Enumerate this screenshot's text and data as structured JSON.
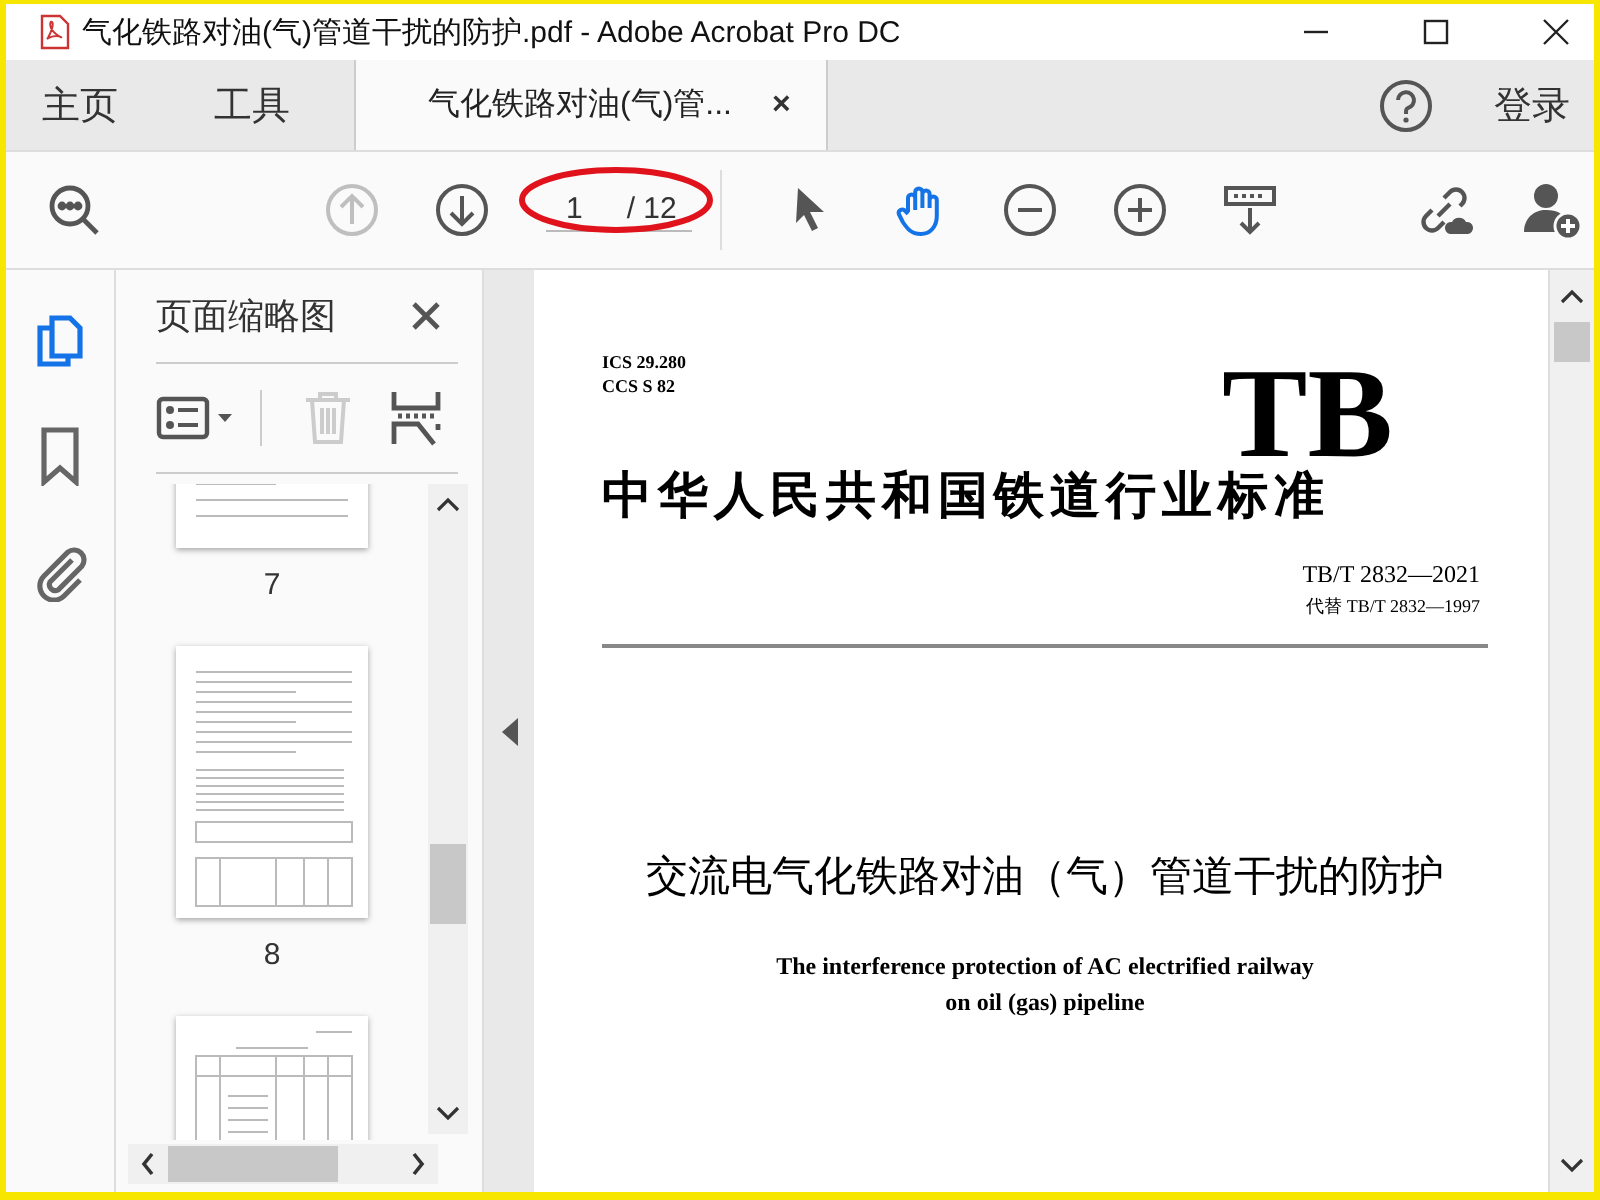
{
  "window": {
    "title": "气化铁路对油(气)管道干扰的防护.pdf - Adobe Acrobat Pro DC"
  },
  "nav_tabs": [
    {
      "label": "主页",
      "selected": false
    },
    {
      "label": "工具",
      "selected": false
    }
  ],
  "document_tab": {
    "label": "气化铁路对油(气)管...",
    "selected": true,
    "close": "×"
  },
  "account": {
    "label": "登录"
  },
  "nav_tools": [
    {
      "kind": "search",
      "disabled": false
    },
    {
      "kind": "page-up",
      "disabled": true
    },
    {
      "kind": "page-down",
      "disabled": false
    }
  ],
  "page_field": {
    "current": "1",
    "total": "/ 12"
  },
  "view_tools": [
    {
      "kind": "pointer",
      "selected": false
    },
    {
      "kind": "hand",
      "selected": true
    },
    {
      "kind": "zoom-out",
      "selected": false
    },
    {
      "kind": "zoom-in",
      "selected": false
    },
    {
      "kind": "fit",
      "selected": false
    }
  ],
  "share_tools": [
    {
      "kind": "link"
    },
    {
      "kind": "add-user"
    }
  ],
  "side_rail": [
    {
      "kind": "pages",
      "selected": true
    },
    {
      "kind": "bookmarks",
      "selected": false
    },
    {
      "kind": "attachments",
      "selected": false
    }
  ],
  "thumbnail_panel": {
    "title": "页面缩略图",
    "tools": [
      {
        "kind": "options",
        "disabled": false
      },
      {
        "kind": "delete",
        "disabled": true
      },
      {
        "kind": "extract",
        "disabled": false
      }
    ],
    "thumbnails": [
      {
        "kind": "text",
        "label": "7"
      },
      {
        "kind": "mixed",
        "label": "8"
      },
      {
        "kind": "table"
      }
    ]
  },
  "document": {
    "codes": [
      "ICS 29.280",
      "CCS S 82"
    ],
    "logo": "TB",
    "heading": "中华人民共和国铁道行业标准",
    "number": "TB/T 2832—2021",
    "replaces": "代替 TB/T 2832—1997",
    "title_zh": "交流电气化铁路对油（气）管道干扰的防护",
    "title_en": [
      "The interference protection of AC electrified railway",
      "on oil (gas) pipeline"
    ]
  }
}
